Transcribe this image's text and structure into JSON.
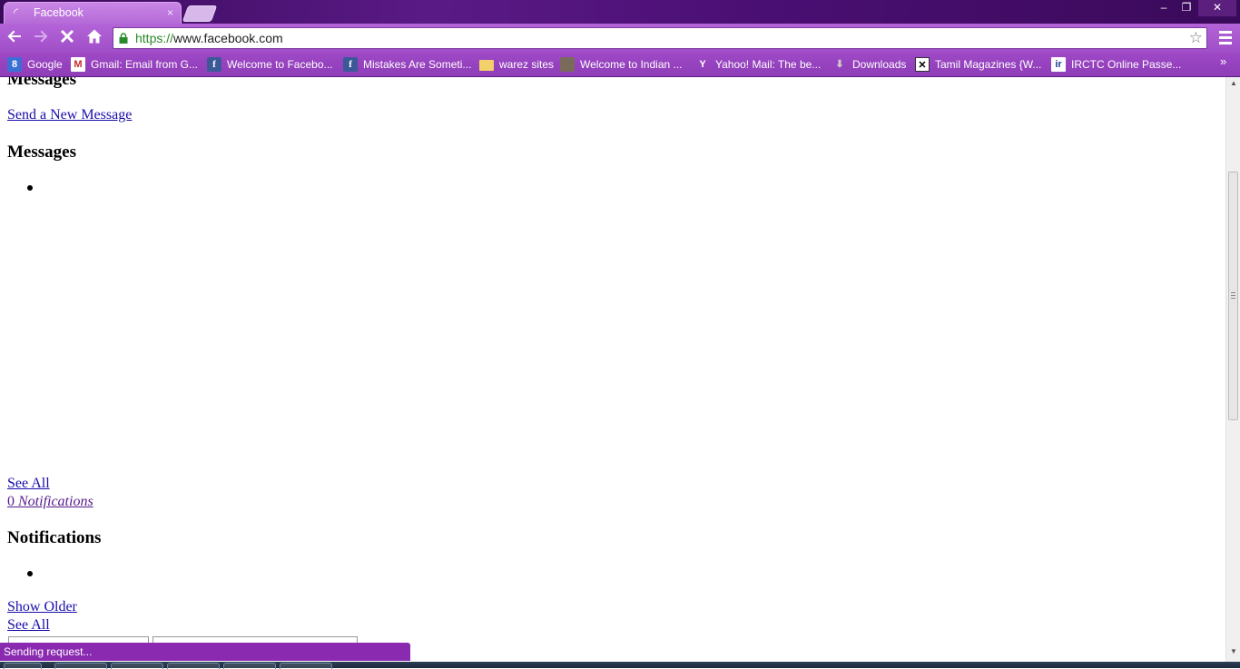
{
  "window": {
    "tab_title": "Facebook",
    "tab_close": "×",
    "controls": {
      "minimize": "–",
      "maximize": "❐",
      "close": "✕"
    }
  },
  "toolbar": {
    "url_scheme": "https://",
    "url_rest": "www.facebook.com",
    "back": "🡐",
    "forward": "🡒",
    "stop": "✕",
    "home": "⌂",
    "star": "☆"
  },
  "bookmarks": {
    "items": [
      {
        "label": "Google",
        "icon": "google-icon"
      },
      {
        "label": "Gmail: Email from G...",
        "icon": "gmail-icon"
      },
      {
        "label": "Welcome to Facebo...",
        "icon": "facebook-icon"
      },
      {
        "label": "Mistakes Are Someti...",
        "icon": "facebook-icon"
      },
      {
        "label": "warez sites",
        "icon": "folder-icon"
      },
      {
        "label": "Welcome to Indian ...",
        "icon": "site-icon"
      },
      {
        "label": "Yahoo! Mail: The be...",
        "icon": "yahoo-icon"
      },
      {
        "label": "Downloads",
        "icon": "download-icon"
      },
      {
        "label": "Tamil Magazines {W...",
        "icon": "site-icon"
      },
      {
        "label": "IRCTC Online Passe...",
        "icon": "irctc-icon"
      }
    ],
    "more": "»"
  },
  "page": {
    "messages_heading_top": "Messages",
    "send_new_message": "Send a New Message",
    "messages_heading": "Messages",
    "see_all_1": "See All",
    "notifications_count": "0",
    "notifications_label": "Notifications",
    "notifications_heading": "Notifications",
    "show_older": "Show Older",
    "see_all_2": "See All"
  },
  "status": {
    "text": "Sending request..."
  },
  "colors": {
    "chrome_purple": "#a04ec8",
    "link_blue": "#1a0dab",
    "status_purple": "#8a2ab0"
  }
}
